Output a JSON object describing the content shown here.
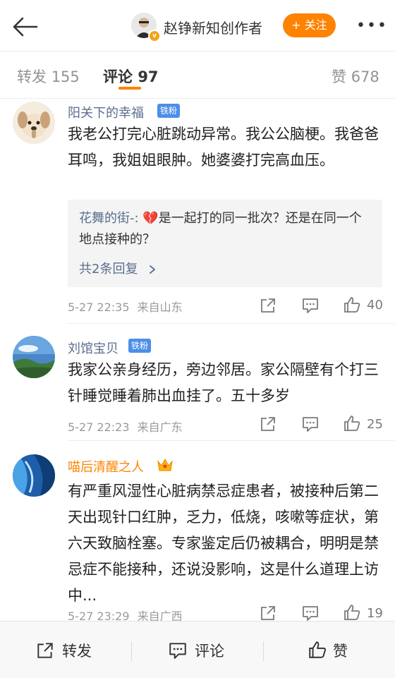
{
  "header": {
    "author_name": "赵铮新知创作者",
    "follow_label": "+ 关注",
    "verified_badge": "v",
    "back_icon": "back-arrow-icon",
    "more_icon": "more-dots-icon",
    "more_label": "•••"
  },
  "tabs": {
    "repost_label": "转发",
    "repost_count": "155",
    "comment_label": "评论",
    "comment_count": "97",
    "likes_label": "赞",
    "likes_count": "678",
    "active_color": "#ff8200"
  },
  "comments": [
    {
      "user": "阳关下的幸福",
      "badge": "铁粉",
      "text": "我老公打完心脏跳动异常。我公公脑梗。我爸爸耳鸣，我姐姐眼肿。她婆婆打完高血压。",
      "reply": {
        "user": "花舞的街-:",
        "emoji": "💔",
        "text": "是一起打的同一批次？还是在同一个地点接种的？",
        "more": "共2条回复"
      },
      "time": "5-27 22:35",
      "location": "来自山东",
      "likes": "40"
    },
    {
      "user": "刘馆宝贝",
      "badge": "铁粉",
      "text": "我家公亲身经历，旁边邻居。家公隔壁有个打三针睡觉睡着肺出血挂了。五十多岁",
      "time": "5-27 22:23",
      "location": "来自广东",
      "likes": "25"
    },
    {
      "user": "喵后清醒之人",
      "badge_icon": "crown-icon",
      "text": "有严重风湿性心脏病禁忌症患者，被接种后第二天出现针口红肿，乏力，低烧，咳嗽等症状，第六天致脑栓塞。专家鉴定后仍被耦合，明明是禁忌症不能接种，还说没影响，这是什么道理上访中...",
      "time": "5-27 23:29",
      "location": "来自广西",
      "likes": "19"
    }
  ],
  "bottom_bar": {
    "repost_label": "转发",
    "comment_label": "评论",
    "like_label": "赞"
  },
  "colors": {
    "accent": "#ff8200",
    "link": "#5a6e8c",
    "fan_badge": "#4d8fe8"
  }
}
